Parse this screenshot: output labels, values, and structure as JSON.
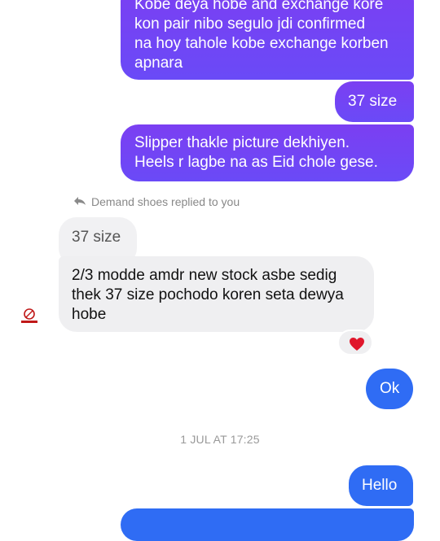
{
  "messages": {
    "out_1": "Kobe deya hobe and exchange kore\nkon pair nibo segulo jdi confirmed\nna hoy tahole kobe exchange korben\napnara",
    "out_2": "37 size",
    "out_3": "Slipper thakle picture  dekhiyen.\nHeels r lagbe na as Eid chole gese.",
    "reply_note": "Demand shoes replied to you",
    "quoted": "37 size",
    "in_1": "2/3 modde amdr new stock asbe sedig\nthek 37 size pochodo koren seta dewya\nhobe",
    "out_4": "Ok",
    "timestamp": "1 JUL AT 17:25",
    "out_5": "Hello"
  },
  "reaction": {
    "icon": "heart-icon",
    "color": "#e0162b"
  },
  "avatar": {
    "icon": "demand-shoes-logo",
    "color": "#c01818"
  },
  "colors": {
    "purple": "#7b3ff2",
    "blue": "#2f6cf4",
    "incoming": "#efeff1"
  }
}
